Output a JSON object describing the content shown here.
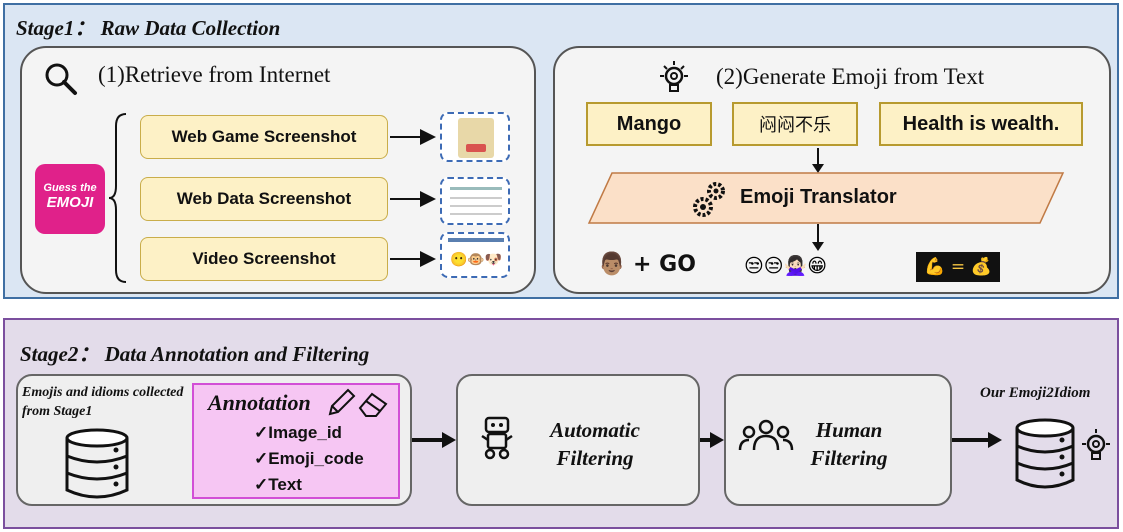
{
  "stage1": {
    "title": "Stage1： Raw Data Collection",
    "panel1": {
      "title": "(1)Retrieve from Internet",
      "logo": {
        "line1": "Guess the",
        "line2": "EMOJI"
      },
      "sources": [
        "Web Game Screenshot",
        "Web Data Screenshot",
        "Video Screenshot"
      ]
    },
    "panel2": {
      "title": "(2)Generate Emoji from Text",
      "inputs": [
        "Mango",
        "闷闷不乐",
        "Health is wealth."
      ],
      "translator": "Emoji Translator",
      "outputs": [
        "👨🏽 + GO",
        "😒😒🙅🏻‍♀️😁",
        "💪 = 💰"
      ]
    }
  },
  "stage2": {
    "title": "Stage2： Data Annotation and Filtering",
    "source_caption": "Emojis and idioms collected from Stage1",
    "annotation": {
      "title": "Annotation",
      "fields": [
        "✓Image_id",
        "✓Emoji_code",
        "✓Text"
      ]
    },
    "automatic_filter": {
      "line1": "Automatic",
      "line2": "Filtering"
    },
    "human_filter": {
      "line1": "Human",
      "line2": "Filtering"
    },
    "result": "Our Emoji2Idiom"
  },
  "icons": [
    "search-icon",
    "lightbulb-icon",
    "gears-icon",
    "pencil-icon",
    "eraser-icon",
    "database-icon",
    "robot-icon",
    "people-icon"
  ],
  "colors": {
    "stage1_fill": "#dbe6f3",
    "stage1_border": "#3f6fa3",
    "stage2_fill": "#e3dcea",
    "stage2_border": "#7b4f9e",
    "source_fill": "#fdf1c6",
    "translator_fill": "#fbe0c8",
    "annotation_fill": "#f6c6f3",
    "annotation_border": "#d24fd6",
    "logo": "#e0218a"
  }
}
